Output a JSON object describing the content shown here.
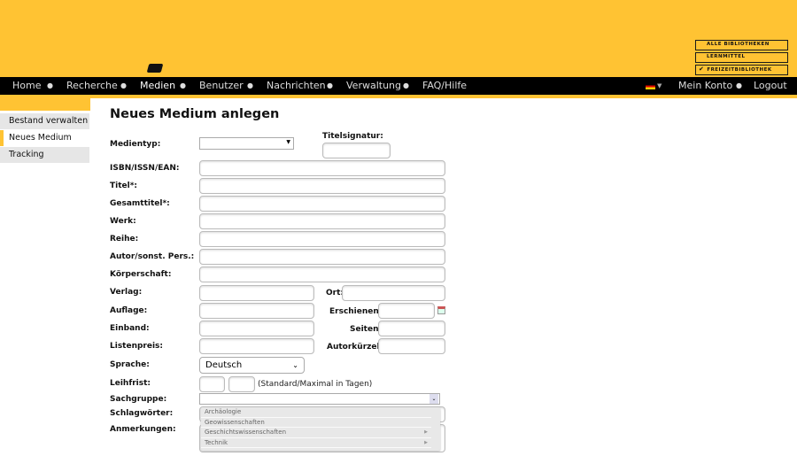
{
  "libraries": [
    {
      "label": "ALLE BIBLIOTHEKEN",
      "checked": false
    },
    {
      "label": "LERNMITTEL",
      "checked": false
    },
    {
      "label": "FREIZEITBIBLIOTHEK",
      "checked": true
    }
  ],
  "nav": {
    "items": [
      "Home",
      "Recherche",
      "Medien",
      "Benutzer",
      "Nachrichten",
      "Verwaltung",
      "FAQ/Hilfe"
    ],
    "active": "Medien",
    "account": "Mein Konto",
    "logout": "Logout",
    "language_icon": "german-flag-icon"
  },
  "sidebar": {
    "items": [
      "Bestand verwalten",
      "Neues Medium",
      "Tracking"
    ],
    "active": "Neues Medium"
  },
  "page_title": "Neues Medium anlegen",
  "form": {
    "medientyp": "Medientyp:",
    "titelsignatur": "Titelsignatur:",
    "isbn": "ISBN/ISSN/EAN:",
    "titel": "Titel*:",
    "gesamttitel": "Gesamttitel*:",
    "werk": "Werk:",
    "reihe": "Reihe:",
    "autor": "Autor/sonst. Pers.:",
    "koerperschaft": "Körperschaft:",
    "verlag": "Verlag:",
    "ort": "Ort:",
    "auflage": "Auflage:",
    "erschienen": "Erschienen:",
    "einband": "Einband:",
    "seiten": "Seiten:",
    "listenpreis": "Listenpreis:",
    "autorkuerzel": "Autorkürzel:",
    "sprache": "Sprache:",
    "sprache_value": "Deutsch",
    "leihfrist": "Leihfrist:",
    "leihfrist_hint": "(Standard/Maximal in Tagen)",
    "sachgruppe": "Sachgruppe:",
    "schlagwoerter": "Schlagwörter:",
    "anmerkungen": "Anmerkungen:"
  },
  "sachgruppe_options": [
    {
      "label": "Archäologie",
      "submenu": false
    },
    {
      "label": "Geowissenschaften",
      "submenu": false
    },
    {
      "label": "Geschichtswissenschaften",
      "submenu": true
    },
    {
      "label": "Technik",
      "submenu": true
    }
  ],
  "colors": {
    "brand": "#ffc333",
    "nav": "#000000"
  }
}
